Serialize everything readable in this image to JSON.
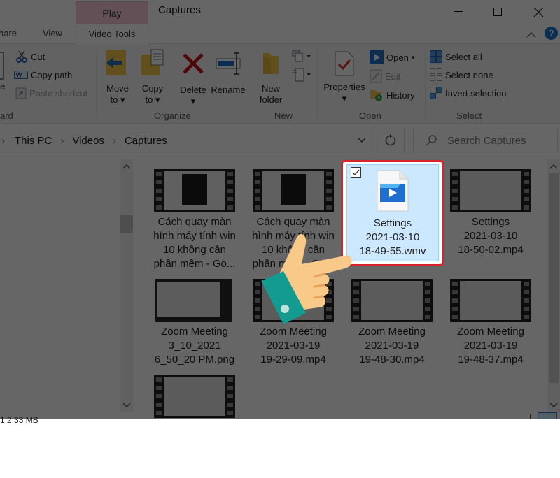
{
  "window": {
    "title": "Captures",
    "contextual_tab": "Play",
    "contextual_group": "Video Tools",
    "controls": {
      "minimize": "minimize-icon",
      "maximize": "maximize-icon",
      "close": "close-icon"
    }
  },
  "tabs": [
    "hare",
    "View"
  ],
  "ribbon": {
    "clipboard": {
      "label": "ard",
      "partial_left": "e",
      "cut": "Cut",
      "copy_path": "Copy path",
      "paste_shortcut": "Paste shortcut"
    },
    "organize": {
      "label": "Organize",
      "move_to": [
        "Move",
        "to"
      ],
      "copy_to": [
        "Copy",
        "to"
      ],
      "delete": "Delete",
      "rename": "Rename"
    },
    "new": {
      "label": "New",
      "new_folder": [
        "New",
        "folder"
      ]
    },
    "open": {
      "label": "Open",
      "properties": "Properties",
      "open": "Open",
      "edit": "Edit",
      "history": "History"
    },
    "select": {
      "label": "Select",
      "select_all": "Select all",
      "select_none": "Select none",
      "invert_selection": "Invert selection"
    }
  },
  "address": {
    "breadcrumb": [
      "This PC",
      "Videos",
      "Captures"
    ],
    "search_placeholder": "Search Captures"
  },
  "files": [
    {
      "name": [
        "Cách quay màn",
        "hình máy tính win",
        "10 không cần",
        "phần mềm - Go..."
      ],
      "type": "video"
    },
    {
      "name": [
        "Cách quay màn",
        "hình máy tính win",
        "10 không cần",
        "phần mềm - Go..."
      ],
      "type": "video"
    },
    {
      "name": [
        "Settings",
        "2021-03-10",
        "18-49-55.wmv"
      ],
      "type": "wmv",
      "selected": true,
      "checked": true
    },
    {
      "name": [
        "Settings",
        "2021-03-10",
        "18-50-02.mp4"
      ],
      "type": "video"
    },
    {
      "name": [
        "Zoom Meeting",
        "3_10_2021",
        "6_50_20 PM.png"
      ],
      "type": "image"
    },
    {
      "name": [
        "Zoom Meeting",
        "2021-03-19",
        "19-29-09.mp4"
      ],
      "type": "video"
    },
    {
      "name": [
        "Zoom Meeting",
        "2021-03-19",
        "19-48-30.mp4"
      ],
      "type": "video"
    },
    {
      "name": [
        "Zoom Meeting",
        "2021-03-19",
        "19-48-37.mp4"
      ],
      "type": "video"
    },
    {
      "name": [],
      "type": "video"
    }
  ],
  "status": {
    "partial": "1 2 33 MB"
  },
  "overlay": {
    "pointer": "pointing-hand-icon",
    "highlight_color": "#d8232a"
  }
}
